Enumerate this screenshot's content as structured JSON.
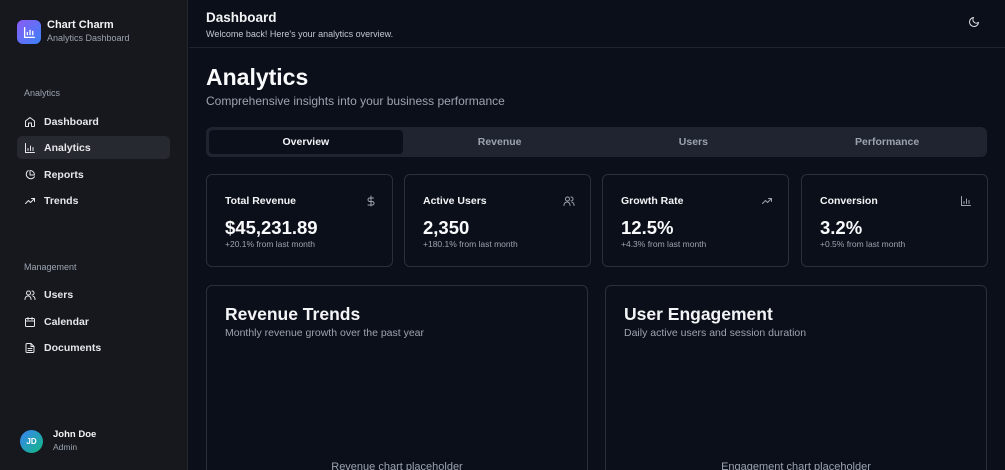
{
  "brand": {
    "title": "Chart Charm",
    "subtitle": "Analytics Dashboard",
    "logo_icon": "bar-chart-icon"
  },
  "sidebar": {
    "section1": "Analytics",
    "items1": [
      {
        "label": "Dashboard",
        "icon": "home-icon"
      },
      {
        "label": "Analytics",
        "icon": "bar-chart-icon",
        "active": true
      },
      {
        "label": "Reports",
        "icon": "pie-chart-icon"
      },
      {
        "label": "Trends",
        "icon": "trending-up-icon"
      }
    ],
    "section2": "Management",
    "items2": [
      {
        "label": "Users",
        "icon": "users-icon"
      },
      {
        "label": "Calendar",
        "icon": "calendar-icon"
      },
      {
        "label": "Documents",
        "icon": "file-icon"
      }
    ]
  },
  "user": {
    "initials": "JD",
    "name": "John Doe",
    "role": "Admin"
  },
  "header": {
    "title": "Dashboard",
    "subtitle": "Welcome back! Here's your analytics overview.",
    "theme_icon": "moon-icon"
  },
  "main": {
    "title": "Analytics",
    "subtitle": "Comprehensive insights into your business performance",
    "tabs": [
      {
        "label": "Overview",
        "active": true
      },
      {
        "label": "Revenue"
      },
      {
        "label": "Users"
      },
      {
        "label": "Performance"
      }
    ],
    "cards": [
      {
        "label": "Total Revenue",
        "value": "$45,231.89",
        "delta": "+20.1% from last month",
        "icon": "dollar-icon"
      },
      {
        "label": "Active Users",
        "value": "2,350",
        "delta": "+180.1% from last month",
        "icon": "users-icon"
      },
      {
        "label": "Growth Rate",
        "value": "12.5%",
        "delta": "+4.3% from last month",
        "icon": "trending-up-icon"
      },
      {
        "label": "Conversion",
        "value": "3.2%",
        "delta": "+0.5% from last month",
        "icon": "bar-chart-icon"
      }
    ],
    "panels": [
      {
        "title": "Revenue Trends",
        "subtitle": "Monthly revenue growth over the past year",
        "placeholder": "Revenue chart placeholder"
      },
      {
        "title": "User Engagement",
        "subtitle": "Daily active users and session duration",
        "placeholder": "Engagement chart placeholder"
      }
    ]
  },
  "colors": {
    "background": "#0b0f1a",
    "sidebar": "#16181d",
    "accent_start": "#8b5cf6",
    "accent_end": "#3b82f6"
  }
}
